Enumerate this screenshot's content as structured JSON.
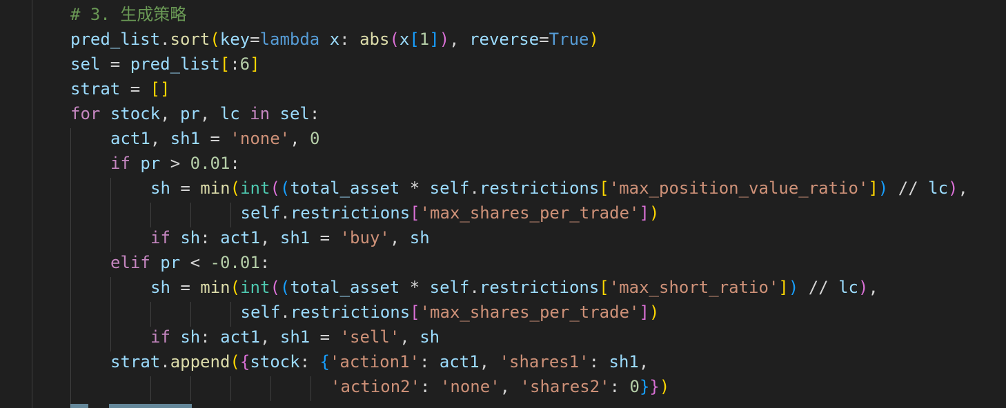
{
  "editor": {
    "language": "python",
    "lines": [
      {
        "indent": 0,
        "tokens": [
          {
            "t": "# 3. 生成策略",
            "c": "comment"
          }
        ]
      },
      {
        "indent": 0,
        "tokens": [
          {
            "t": "pred_list",
            "c": "var"
          },
          {
            "t": ".",
            "c": "op"
          },
          {
            "t": "sort",
            "c": "fn"
          },
          {
            "t": "(",
            "c": "b1"
          },
          {
            "t": "key",
            "c": "var"
          },
          {
            "t": "=",
            "c": "op"
          },
          {
            "t": "lambda",
            "c": "kw"
          },
          {
            "t": " ",
            "c": "op"
          },
          {
            "t": "x",
            "c": "var"
          },
          {
            "t": ": ",
            "c": "op"
          },
          {
            "t": "abs",
            "c": "fn"
          },
          {
            "t": "(",
            "c": "b2"
          },
          {
            "t": "x",
            "c": "var"
          },
          {
            "t": "[",
            "c": "b3"
          },
          {
            "t": "1",
            "c": "num"
          },
          {
            "t": "]",
            "c": "b3"
          },
          {
            "t": ")",
            "c": "b2"
          },
          {
            "t": ", ",
            "c": "op"
          },
          {
            "t": "reverse",
            "c": "var"
          },
          {
            "t": "=",
            "c": "op"
          },
          {
            "t": "True",
            "c": "kw"
          },
          {
            "t": ")",
            "c": "b1"
          }
        ]
      },
      {
        "indent": 0,
        "tokens": [
          {
            "t": "sel",
            "c": "var"
          },
          {
            "t": " = ",
            "c": "op"
          },
          {
            "t": "pred_list",
            "c": "var"
          },
          {
            "t": "[",
            "c": "b1"
          },
          {
            "t": ":",
            "c": "op"
          },
          {
            "t": "6",
            "c": "num"
          },
          {
            "t": "]",
            "c": "b1"
          }
        ]
      },
      {
        "indent": 0,
        "tokens": [
          {
            "t": "strat",
            "c": "var"
          },
          {
            "t": " = ",
            "c": "op"
          },
          {
            "t": "[]",
            "c": "b1"
          }
        ]
      },
      {
        "indent": 0,
        "tokens": [
          {
            "t": "for",
            "c": "ctrl"
          },
          {
            "t": " ",
            "c": "op"
          },
          {
            "t": "stock",
            "c": "var"
          },
          {
            "t": ", ",
            "c": "op"
          },
          {
            "t": "pr",
            "c": "var"
          },
          {
            "t": ", ",
            "c": "op"
          },
          {
            "t": "lc",
            "c": "var"
          },
          {
            "t": " ",
            "c": "op"
          },
          {
            "t": "in",
            "c": "ctrl"
          },
          {
            "t": " ",
            "c": "op"
          },
          {
            "t": "sel",
            "c": "var"
          },
          {
            "t": ":",
            "c": "op"
          }
        ]
      },
      {
        "indent": 4,
        "tokens": [
          {
            "t": "act1",
            "c": "var"
          },
          {
            "t": ", ",
            "c": "op"
          },
          {
            "t": "sh1",
            "c": "var"
          },
          {
            "t": " = ",
            "c": "op"
          },
          {
            "t": "'none'",
            "c": "str"
          },
          {
            "t": ", ",
            "c": "op"
          },
          {
            "t": "0",
            "c": "num"
          }
        ]
      },
      {
        "indent": 4,
        "tokens": [
          {
            "t": "if",
            "c": "ctrl"
          },
          {
            "t": " ",
            "c": "op"
          },
          {
            "t": "pr",
            "c": "var"
          },
          {
            "t": " > ",
            "c": "op"
          },
          {
            "t": "0.01",
            "c": "num"
          },
          {
            "t": ":",
            "c": "op"
          }
        ]
      },
      {
        "indent": 8,
        "tokens": [
          {
            "t": "sh",
            "c": "var"
          },
          {
            "t": " = ",
            "c": "op"
          },
          {
            "t": "min",
            "c": "fn"
          },
          {
            "t": "(",
            "c": "b1"
          },
          {
            "t": "int",
            "c": "cls"
          },
          {
            "t": "(",
            "c": "b2"
          },
          {
            "t": "(",
            "c": "b3"
          },
          {
            "t": "total_asset",
            "c": "var"
          },
          {
            "t": " * ",
            "c": "op"
          },
          {
            "t": "self",
            "c": "var"
          },
          {
            "t": ".",
            "c": "op"
          },
          {
            "t": "restrictions",
            "c": "var"
          },
          {
            "t": "[",
            "c": "b1"
          },
          {
            "t": "'max_position_value_ratio'",
            "c": "str"
          },
          {
            "t": "]",
            "c": "b1"
          },
          {
            "t": ")",
            "c": "b3"
          },
          {
            "t": " // ",
            "c": "op"
          },
          {
            "t": "lc",
            "c": "var"
          },
          {
            "t": ")",
            "c": "b2"
          },
          {
            "t": ",",
            "c": "op"
          }
        ]
      },
      {
        "indent": 17,
        "tokens": [
          {
            "t": "self",
            "c": "var"
          },
          {
            "t": ".",
            "c": "op"
          },
          {
            "t": "restrictions",
            "c": "var"
          },
          {
            "t": "[",
            "c": "b2"
          },
          {
            "t": "'max_shares_per_trade'",
            "c": "str"
          },
          {
            "t": "]",
            "c": "b2"
          },
          {
            "t": ")",
            "c": "b1"
          }
        ]
      },
      {
        "indent": 8,
        "tokens": [
          {
            "t": "if",
            "c": "ctrl"
          },
          {
            "t": " ",
            "c": "op"
          },
          {
            "t": "sh",
            "c": "var"
          },
          {
            "t": ": ",
            "c": "op"
          },
          {
            "t": "act1",
            "c": "var"
          },
          {
            "t": ", ",
            "c": "op"
          },
          {
            "t": "sh1",
            "c": "var"
          },
          {
            "t": " = ",
            "c": "op"
          },
          {
            "t": "'buy'",
            "c": "str"
          },
          {
            "t": ", ",
            "c": "op"
          },
          {
            "t": "sh",
            "c": "var"
          }
        ]
      },
      {
        "indent": 4,
        "tokens": [
          {
            "t": "elif",
            "c": "ctrl"
          },
          {
            "t": " ",
            "c": "op"
          },
          {
            "t": "pr",
            "c": "var"
          },
          {
            "t": " < ",
            "c": "op"
          },
          {
            "t": "-0.01",
            "c": "num"
          },
          {
            "t": ":",
            "c": "op"
          }
        ]
      },
      {
        "indent": 8,
        "tokens": [
          {
            "t": "sh",
            "c": "var"
          },
          {
            "t": " = ",
            "c": "op"
          },
          {
            "t": "min",
            "c": "fn"
          },
          {
            "t": "(",
            "c": "b1"
          },
          {
            "t": "int",
            "c": "cls"
          },
          {
            "t": "(",
            "c": "b2"
          },
          {
            "t": "(",
            "c": "b3"
          },
          {
            "t": "total_asset",
            "c": "var"
          },
          {
            "t": " * ",
            "c": "op"
          },
          {
            "t": "self",
            "c": "var"
          },
          {
            "t": ".",
            "c": "op"
          },
          {
            "t": "restrictions",
            "c": "var"
          },
          {
            "t": "[",
            "c": "b1"
          },
          {
            "t": "'max_short_ratio'",
            "c": "str"
          },
          {
            "t": "]",
            "c": "b1"
          },
          {
            "t": ")",
            "c": "b3"
          },
          {
            "t": " // ",
            "c": "op"
          },
          {
            "t": "lc",
            "c": "var"
          },
          {
            "t": ")",
            "c": "b2"
          },
          {
            "t": ",",
            "c": "op"
          }
        ]
      },
      {
        "indent": 17,
        "tokens": [
          {
            "t": "self",
            "c": "var"
          },
          {
            "t": ".",
            "c": "op"
          },
          {
            "t": "restrictions",
            "c": "var"
          },
          {
            "t": "[",
            "c": "b2"
          },
          {
            "t": "'max_shares_per_trade'",
            "c": "str"
          },
          {
            "t": "]",
            "c": "b2"
          },
          {
            "t": ")",
            "c": "b1"
          }
        ]
      },
      {
        "indent": 8,
        "tokens": [
          {
            "t": "if",
            "c": "ctrl"
          },
          {
            "t": " ",
            "c": "op"
          },
          {
            "t": "sh",
            "c": "var"
          },
          {
            "t": ": ",
            "c": "op"
          },
          {
            "t": "act1",
            "c": "var"
          },
          {
            "t": ", ",
            "c": "op"
          },
          {
            "t": "sh1",
            "c": "var"
          },
          {
            "t": " = ",
            "c": "op"
          },
          {
            "t": "'sell'",
            "c": "str"
          },
          {
            "t": ", ",
            "c": "op"
          },
          {
            "t": "sh",
            "c": "var"
          }
        ]
      },
      {
        "indent": 4,
        "tokens": [
          {
            "t": "strat",
            "c": "var"
          },
          {
            "t": ".",
            "c": "op"
          },
          {
            "t": "append",
            "c": "fn"
          },
          {
            "t": "(",
            "c": "b1"
          },
          {
            "t": "{",
            "c": "b2"
          },
          {
            "t": "stock",
            "c": "var"
          },
          {
            "t": ": ",
            "c": "op"
          },
          {
            "t": "{",
            "c": "b3"
          },
          {
            "t": "'action1'",
            "c": "str"
          },
          {
            "t": ": ",
            "c": "op"
          },
          {
            "t": "act1",
            "c": "var"
          },
          {
            "t": ", ",
            "c": "op"
          },
          {
            "t": "'shares1'",
            "c": "str"
          },
          {
            "t": ": ",
            "c": "op"
          },
          {
            "t": "sh1",
            "c": "var"
          },
          {
            "t": ",",
            "c": "op"
          }
        ]
      },
      {
        "indent": 26,
        "tokens": [
          {
            "t": "'action2'",
            "c": "str"
          },
          {
            "t": ": ",
            "c": "op"
          },
          {
            "t": "'none'",
            "c": "str"
          },
          {
            "t": ", ",
            "c": "op"
          },
          {
            "t": "'shares2'",
            "c": "str"
          },
          {
            "t": ": ",
            "c": "op"
          },
          {
            "t": "0",
            "c": "num"
          },
          {
            "t": "}",
            "c": "b3"
          },
          {
            "t": "}",
            "c": "b2"
          },
          {
            "t": ")",
            "c": "b1"
          }
        ]
      }
    ]
  }
}
